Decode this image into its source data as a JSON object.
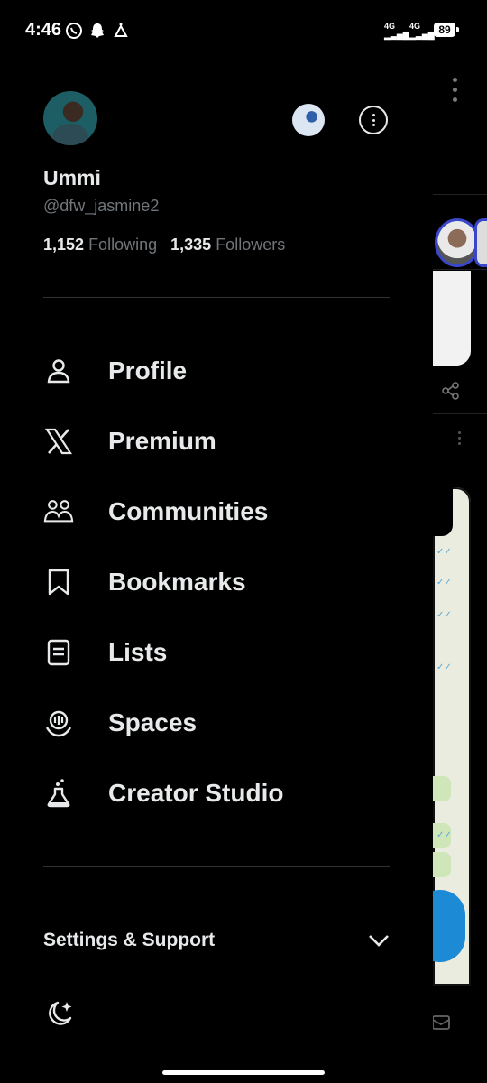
{
  "status_bar": {
    "time": "4:46",
    "signal1": "4G",
    "signal2": "4G",
    "battery": "89"
  },
  "profile": {
    "name": "Ummi",
    "handle": "@dfw_jasmine2",
    "following_count": "1,152",
    "following_label": "Following",
    "followers_count": "1,335",
    "followers_label": "Followers"
  },
  "menu": [
    {
      "label": "Profile",
      "icon": "person-icon"
    },
    {
      "label": "Premium",
      "icon": "x-logo-icon"
    },
    {
      "label": "Communities",
      "icon": "people-icon"
    },
    {
      "label": "Bookmarks",
      "icon": "bookmark-icon"
    },
    {
      "label": "Lists",
      "icon": "list-icon"
    },
    {
      "label": "Spaces",
      "icon": "microphone-icon"
    },
    {
      "label": "Creator Studio",
      "icon": "flask-icon"
    }
  ],
  "settings_section": {
    "label": "Settings & Support"
  },
  "colors": {
    "background": "#000000",
    "text_primary": "#e7e9ea",
    "text_secondary": "#71767b",
    "divider": "#2f3336",
    "fab_blue": "#1d8ad6"
  }
}
